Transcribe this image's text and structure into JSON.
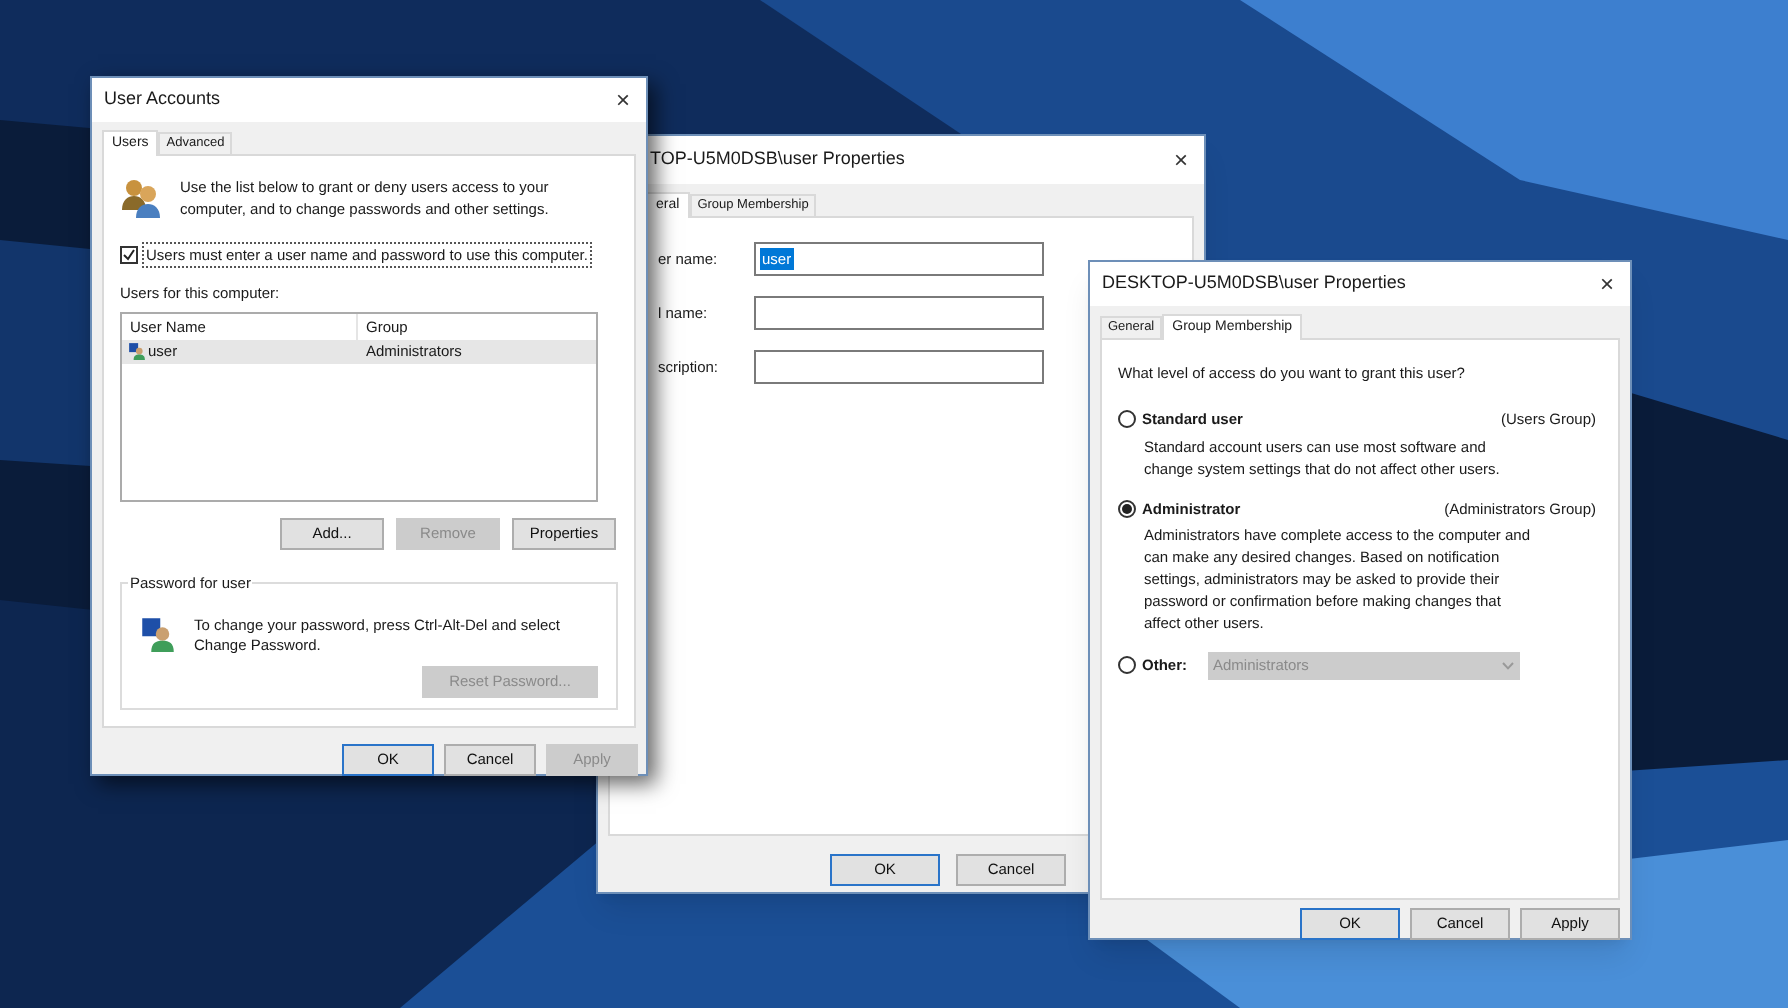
{
  "user_accounts": {
    "title": "User Accounts",
    "close": "×",
    "tabs": [
      {
        "label": "Users",
        "selected": true
      },
      {
        "label": "Advanced",
        "selected": false
      }
    ],
    "intro": "Use the list below to grant or deny users access to your computer, and to change passwords and other settings.",
    "require_login": {
      "label": "Users must enter a user name and password to use this computer.",
      "checked": true
    },
    "list_label": "Users for this computer:",
    "table": {
      "columns": [
        "User Name",
        "Group"
      ],
      "rows": [
        {
          "cells": [
            "user",
            "Administrators"
          ],
          "selected": true
        }
      ]
    },
    "list_buttons": [
      {
        "label": "Add...",
        "disabled": false
      },
      {
        "label": "Remove",
        "disabled": true
      },
      {
        "label": "Properties",
        "disabled": false
      }
    ],
    "password_group": {
      "title": "Password for user",
      "text": "To change your password, press Ctrl-Alt-Del and select Change Password.",
      "button": {
        "label": "Reset Password...",
        "disabled": true
      }
    },
    "buttons": [
      {
        "label": "OK",
        "disabled": false,
        "default": true
      },
      {
        "label": "Cancel",
        "disabled": false,
        "default": false
      },
      {
        "label": "Apply",
        "disabled": true,
        "default": false
      }
    ]
  },
  "properties_back": {
    "title": "TOP-U5M0DSB\\user Properties",
    "close": "×",
    "tabs": [
      {
        "label": "eral",
        "selected": true
      },
      {
        "label": "Group Membership",
        "selected": false
      }
    ],
    "fields": [
      {
        "label": "er name:",
        "value": "user",
        "selected": true
      },
      {
        "label": "l name:"
      },
      {
        "label": "scription:"
      }
    ],
    "buttons": [
      {
        "label": "OK",
        "disabled": false,
        "default": true
      },
      {
        "label": "Cancel",
        "disabled": false,
        "default": false
      }
    ]
  },
  "properties_front": {
    "title": "DESKTOP-U5M0DSB\\user Properties",
    "close": "×",
    "tabs": [
      {
        "label": "General",
        "selected": false
      },
      {
        "label": "Group Membership",
        "selected": true
      }
    ],
    "question": "What level of access do you want to grant this user?",
    "options": [
      {
        "kind": "described",
        "label": "Standard user",
        "group": "(Users Group)",
        "description": "Standard account users can use most software and change system settings that do not affect other users.",
        "selected": false
      },
      {
        "kind": "described",
        "label": "Administrator",
        "group": "(Administrators Group)",
        "description": "Administrators have complete access to the computer and can make any desired changes. Based on notification settings, administrators may be asked to provide their password or confirmation before making changes that affect other users.",
        "selected": true
      },
      {
        "kind": "dropdown",
        "label": "Other:",
        "value": "Administrators",
        "selected": false,
        "disabled": true
      }
    ],
    "buttons": [
      {
        "label": "OK",
        "disabled": false,
        "default": true
      },
      {
        "label": "Cancel",
        "disabled": false,
        "default": false
      },
      {
        "label": "Apply",
        "disabled": false,
        "default": false
      }
    ]
  }
}
